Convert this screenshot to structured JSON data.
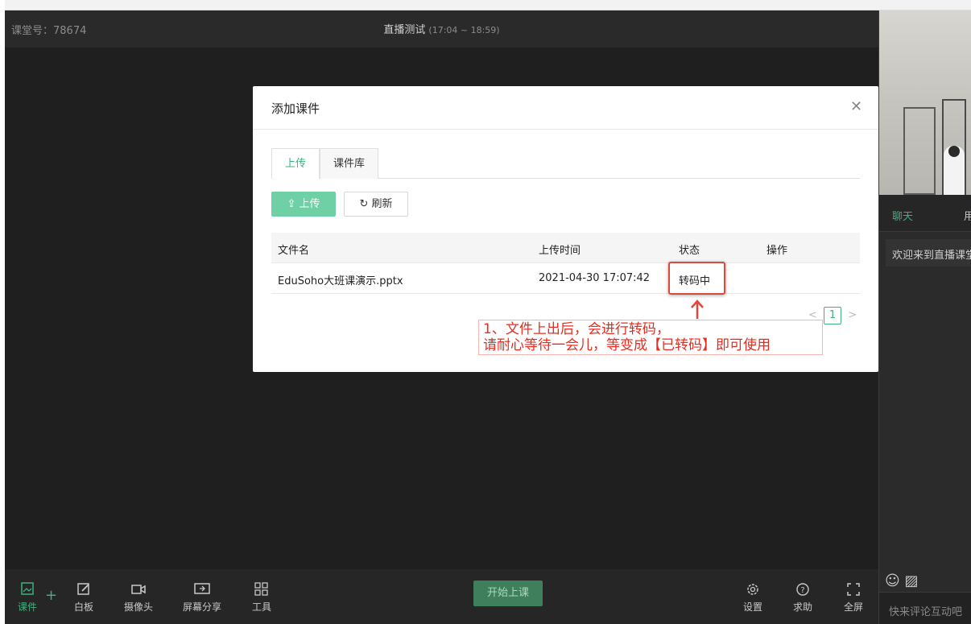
{
  "room": {
    "id_label": "课堂号：78674",
    "title": "直播测试",
    "time": "(17:04 ~ 18:59)"
  },
  "modal": {
    "title": "添加课件",
    "close_icon": "close-icon",
    "tabs": [
      {
        "label": "上传",
        "active": true
      },
      {
        "label": "课件库",
        "active": false
      }
    ],
    "upload_button": "上传",
    "refresh_button": "刷新",
    "table": {
      "headers": [
        "文件名",
        "上传时间",
        "状态",
        "操作"
      ],
      "rows": [
        {
          "filename": "EduSoho大班课演示.pptx",
          "uploaded_at": "2021-04-30 17:07:42",
          "status": "转码中",
          "action": ""
        }
      ]
    },
    "pager": {
      "prev": "<",
      "current": "1",
      "next": ">"
    },
    "note_line1": "1、文件上出后，会进行转码，",
    "note_line2": "请耐心等待一会儿，等变成【已转码】即可使用"
  },
  "toolbar": {
    "items": [
      {
        "label": "课件",
        "icon": "courseware-icon"
      },
      {
        "label": "白板",
        "icon": "whiteboard-icon"
      },
      {
        "label": "摄像头",
        "icon": "camera-icon"
      },
      {
        "label": "屏幕分享",
        "icon": "screen-share-icon"
      },
      {
        "label": "工具",
        "icon": "tools-icon"
      }
    ],
    "start_button": "开始上课",
    "right_items": [
      {
        "label": "设置",
        "icon": "gear-icon"
      },
      {
        "label": "求助",
        "icon": "help-icon"
      },
      {
        "label": "全屏",
        "icon": "fullscreen-icon"
      }
    ]
  },
  "chat": {
    "tab_chat": "聊天",
    "tab_users": "用",
    "welcome": "欢迎来到直播课堂",
    "input_placeholder": "快来评论互动吧"
  },
  "colors": {
    "accent": "#3fb07f",
    "annotation": "#e52d1f"
  }
}
